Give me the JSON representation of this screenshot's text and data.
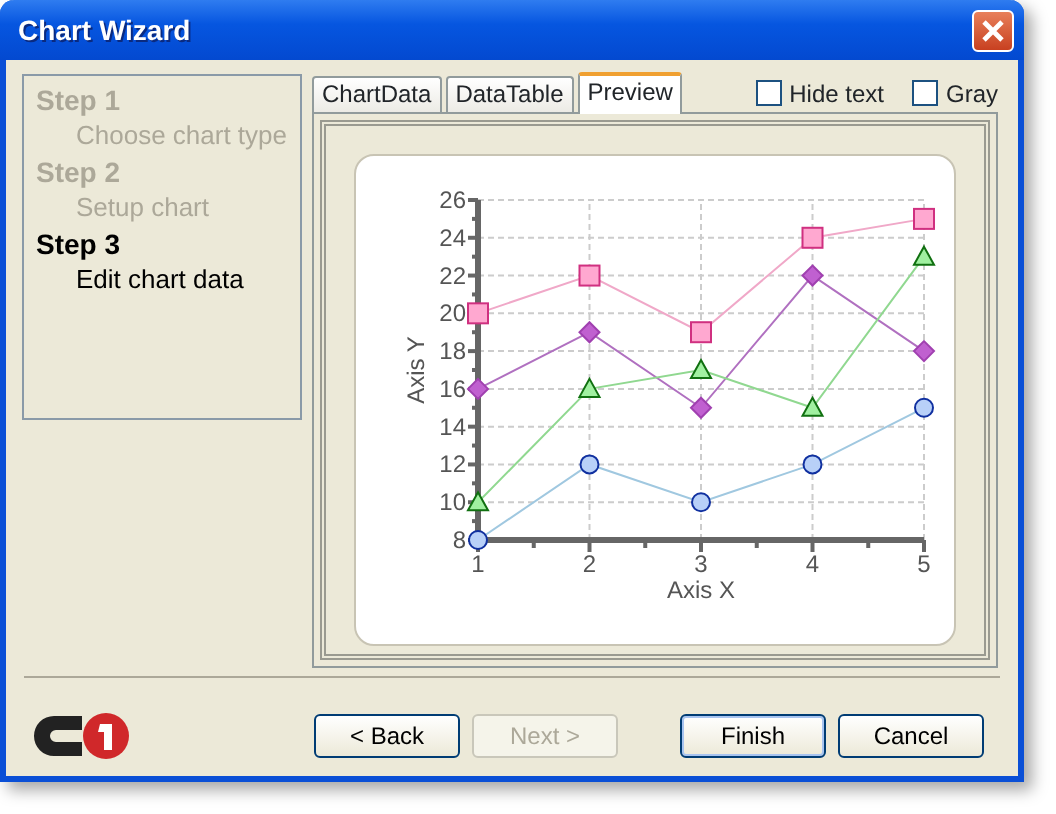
{
  "window": {
    "title": "Chart Wizard"
  },
  "steps": [
    {
      "title": "Step 1",
      "subtitle": "Choose chart type",
      "selected": false
    },
    {
      "title": "Step 2",
      "subtitle": "Setup chart",
      "selected": false
    },
    {
      "title": "Step 3",
      "subtitle": "Edit chart data",
      "selected": true
    }
  ],
  "tabs": [
    {
      "label": "ChartData",
      "selected": false
    },
    {
      "label": "DataTable",
      "selected": false
    },
    {
      "label": "Preview",
      "selected": true
    }
  ],
  "options": [
    {
      "label": "Hide text",
      "checked": false
    },
    {
      "label": "Gray",
      "checked": false
    }
  ],
  "preview": {
    "chart_data": {
      "type": "line",
      "xlabel": "Axis X",
      "ylabel": "Axis Y",
      "x": [
        1,
        2,
        3,
        4,
        5
      ],
      "xticks": [
        1,
        2,
        3,
        4,
        5
      ],
      "xlim": [
        1,
        5
      ],
      "grid": true,
      "ylim": [
        8,
        26
      ],
      "yticks": [
        8,
        10,
        12,
        14,
        16,
        18,
        20,
        22,
        24,
        26
      ],
      "series": [
        {
          "color": "#f0a8c8",
          "marker": "square",
          "values": [
            20,
            22,
            19,
            24,
            25
          ]
        },
        {
          "color": "#b070c0",
          "marker": "diamond",
          "values": [
            16,
            19,
            15,
            22,
            18
          ]
        },
        {
          "color": "#90d890",
          "marker": "triangle",
          "values": [
            10,
            16,
            17,
            15,
            23
          ]
        },
        {
          "color": "#a0c8e0",
          "marker": "circle",
          "values": [
            8,
            12,
            10,
            12,
            15
          ]
        }
      ]
    }
  },
  "buttons": [
    {
      "label": "< Back",
      "disabled": false
    },
    {
      "label": "Next >",
      "disabled": true
    },
    {
      "label": "Finish",
      "disabled": false
    },
    {
      "label": "Cancel",
      "disabled": false
    }
  ]
}
